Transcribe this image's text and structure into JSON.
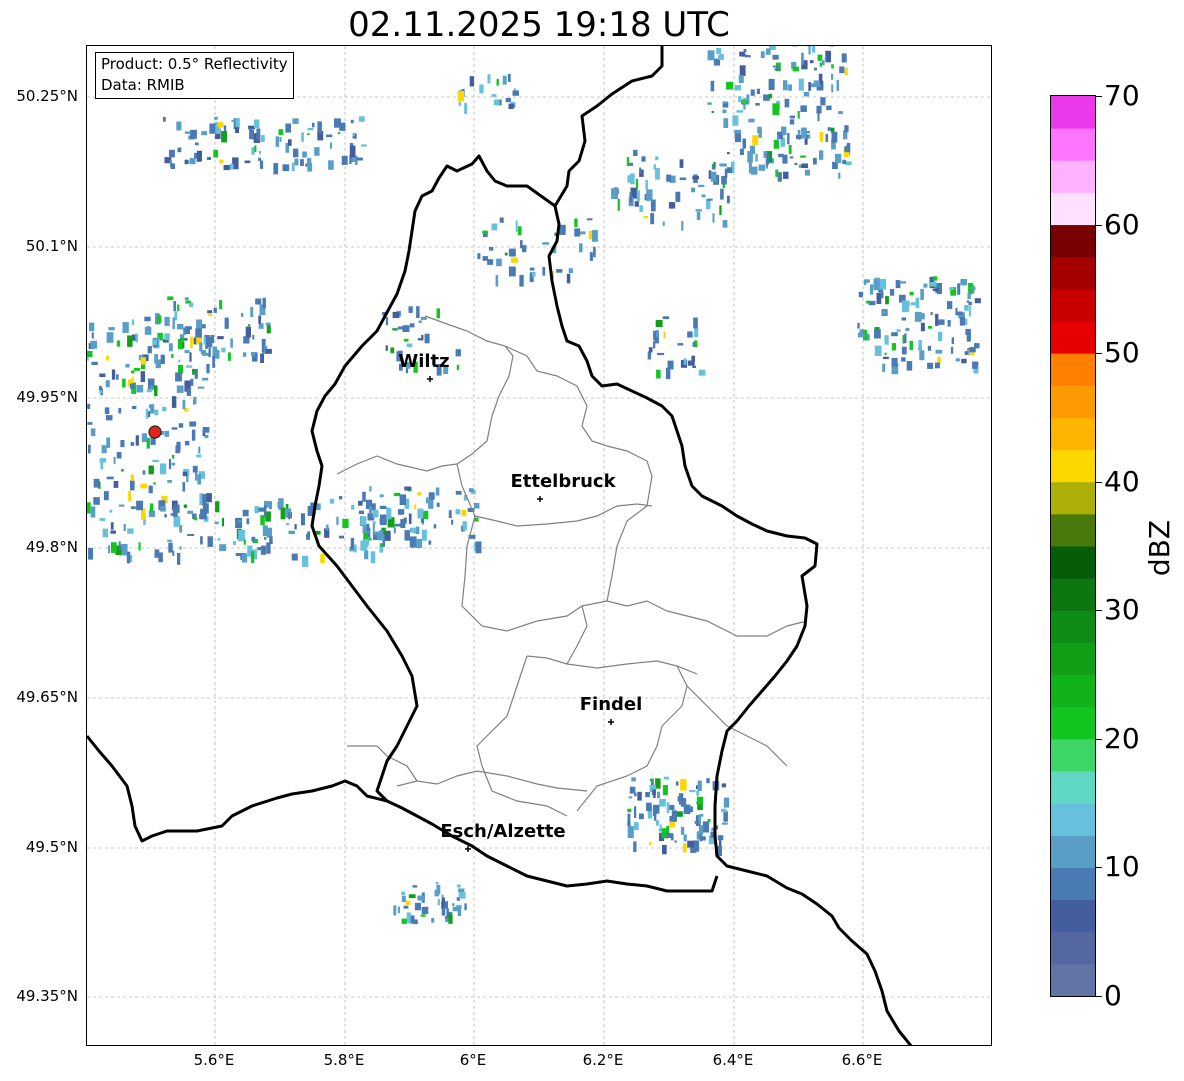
{
  "title": "02.11.2025 19:18 UTC",
  "info": {
    "product": "Product: 0.5° Reflectivity",
    "data": "Data: RMIB"
  },
  "map": {
    "lat_labels": [
      "50.25°N",
      "50.1°N",
      "49.95°N",
      "49.8°N",
      "49.65°N",
      "49.5°N",
      "49.35°N"
    ],
    "lon_labels": [
      "5.6°E",
      "5.8°E",
      "6°E",
      "6.2°E",
      "6.4°E",
      "6.6°E"
    ],
    "cities": [
      {
        "name": "Wiltz"
      },
      {
        "name": "Ettelbruck"
      },
      {
        "name": "Findel"
      },
      {
        "name": "Esch/Alzette"
      }
    ],
    "radar_site_color": "#e8231b",
    "border_color": "#000000",
    "canton_color": "#808080"
  },
  "colorbar": {
    "label": "dBZ",
    "min": 0,
    "max": 70,
    "ticks": [
      "0",
      "10",
      "20",
      "30",
      "40",
      "50",
      "60",
      "70"
    ],
    "colors": [
      "#6273a6",
      "#55679f",
      "#445d9e",
      "#4a7ab3",
      "#599ec7",
      "#67c1dc",
      "#5fd8c4",
      "#3fd668",
      "#12c51f",
      "#10b41a",
      "#109f17",
      "#0f8c15",
      "#0c7610",
      "#055d09",
      "#49780b",
      "#aeb00a",
      "#ffd700",
      "#ffb500",
      "#ff9a00",
      "#ff7f00",
      "#e60000",
      "#c80000",
      "#a50000",
      "#780000",
      "#ffe1ff",
      "#ffb3ff",
      "#ff75ff",
      "#ea38ea"
    ]
  }
}
